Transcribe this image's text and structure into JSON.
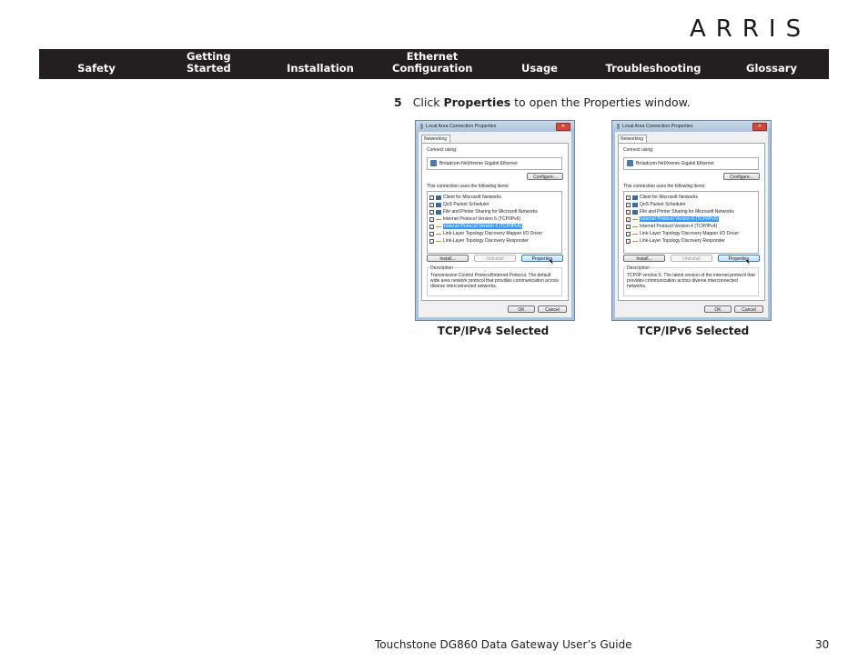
{
  "brand": {
    "logo_text": "ARRIS"
  },
  "nav": {
    "items": [
      {
        "line1": "",
        "line2": "Safety"
      },
      {
        "line1": "Getting",
        "line2": "Started"
      },
      {
        "line1": "",
        "line2": "Installation"
      },
      {
        "line1": "Ethernet",
        "line2": "Configuration"
      },
      {
        "line1": "",
        "line2": "Usage"
      },
      {
        "line1": "",
        "line2": "Troubleshooting"
      },
      {
        "line1": "",
        "line2": "Glossary"
      }
    ]
  },
  "step": {
    "number": "5",
    "prefix": "Click",
    "bold": "Properties",
    "suffix": "to open the Properties window."
  },
  "dialogs": [
    {
      "title": "Local Area Connection Properties",
      "close_glyph": "✕",
      "tab": "Networking",
      "connect_using_label": "Connect using:",
      "adapter": "Broadcom NetXtreme Gigabit Ethernet",
      "configure_button": "Configure...",
      "items_label": "This connection uses the following items:",
      "items": [
        {
          "label": "Client for Microsoft Networks",
          "checked": true,
          "icon": "computer-icon",
          "selected": false
        },
        {
          "label": "QoS Packet Scheduler",
          "checked": true,
          "icon": "computer-icon",
          "selected": false
        },
        {
          "label": "File and Printer Sharing for Microsoft Networks",
          "checked": true,
          "icon": "computer-icon",
          "selected": false
        },
        {
          "label": "Internet Protocol Version 6 (TCP/IPv6)",
          "checked": true,
          "icon": "protocol-icon",
          "selected": false
        },
        {
          "label": "Internet Protocol Version 4 (TCP/IPv4)",
          "checked": true,
          "icon": "protocol-icon",
          "selected": true
        },
        {
          "label": "Link-Layer Topology Discovery Mapper I/O Driver",
          "checked": true,
          "icon": "protocol-icon",
          "selected": false
        },
        {
          "label": "Link-Layer Topology Discovery Responder",
          "checked": true,
          "icon": "protocol-icon",
          "selected": false
        }
      ],
      "install_button": "Install...",
      "uninstall_button": "Uninstall",
      "properties_button": "Properties",
      "description_label": "Description",
      "description_text": "Transmission Control Protocol/Internet Protocol. The default wide area network protocol that provides communication across diverse interconnected networks.",
      "ok_button": "OK",
      "cancel_button": "Cancel",
      "caption": "TCP/IPv4 Selected"
    },
    {
      "title": "Local Area Connection Properties",
      "close_glyph": "✕",
      "tab": "Networking",
      "connect_using_label": "Connect using:",
      "adapter": "Broadcom NetXtreme Gigabit Ethernet",
      "configure_button": "Configure...",
      "items_label": "This connection uses the following items:",
      "items": [
        {
          "label": "Client for Microsoft Networks",
          "checked": true,
          "icon": "computer-icon",
          "selected": false
        },
        {
          "label": "QoS Packet Scheduler",
          "checked": true,
          "icon": "computer-icon",
          "selected": false
        },
        {
          "label": "File and Printer Sharing for Microsoft Networks",
          "checked": true,
          "icon": "computer-icon",
          "selected": false
        },
        {
          "label": "Internet Protocol Version 6 (TCP/IPv6)",
          "checked": true,
          "icon": "protocol-icon",
          "selected": true
        },
        {
          "label": "Internet Protocol Version 4 (TCP/IPv4)",
          "checked": true,
          "icon": "protocol-icon",
          "selected": false
        },
        {
          "label": "Link-Layer Topology Discovery Mapper I/O Driver",
          "checked": true,
          "icon": "protocol-icon",
          "selected": false
        },
        {
          "label": "Link-Layer Topology Discovery Responder",
          "checked": true,
          "icon": "protocol-icon",
          "selected": false
        }
      ],
      "install_button": "Install...",
      "uninstall_button": "Uninstall",
      "properties_button": "Properties",
      "description_label": "Description",
      "description_text": "TCP/IP version 6. The latest version of the internet protocol that provides communication across diverse interconnected networks.",
      "ok_button": "OK",
      "cancel_button": "Cancel",
      "caption": "TCP/IPv6 Selected"
    }
  ],
  "footer": {
    "title": "Touchstone DG860 Data Gateway User’s Guide",
    "page": "30"
  },
  "check_glyph": "✓"
}
